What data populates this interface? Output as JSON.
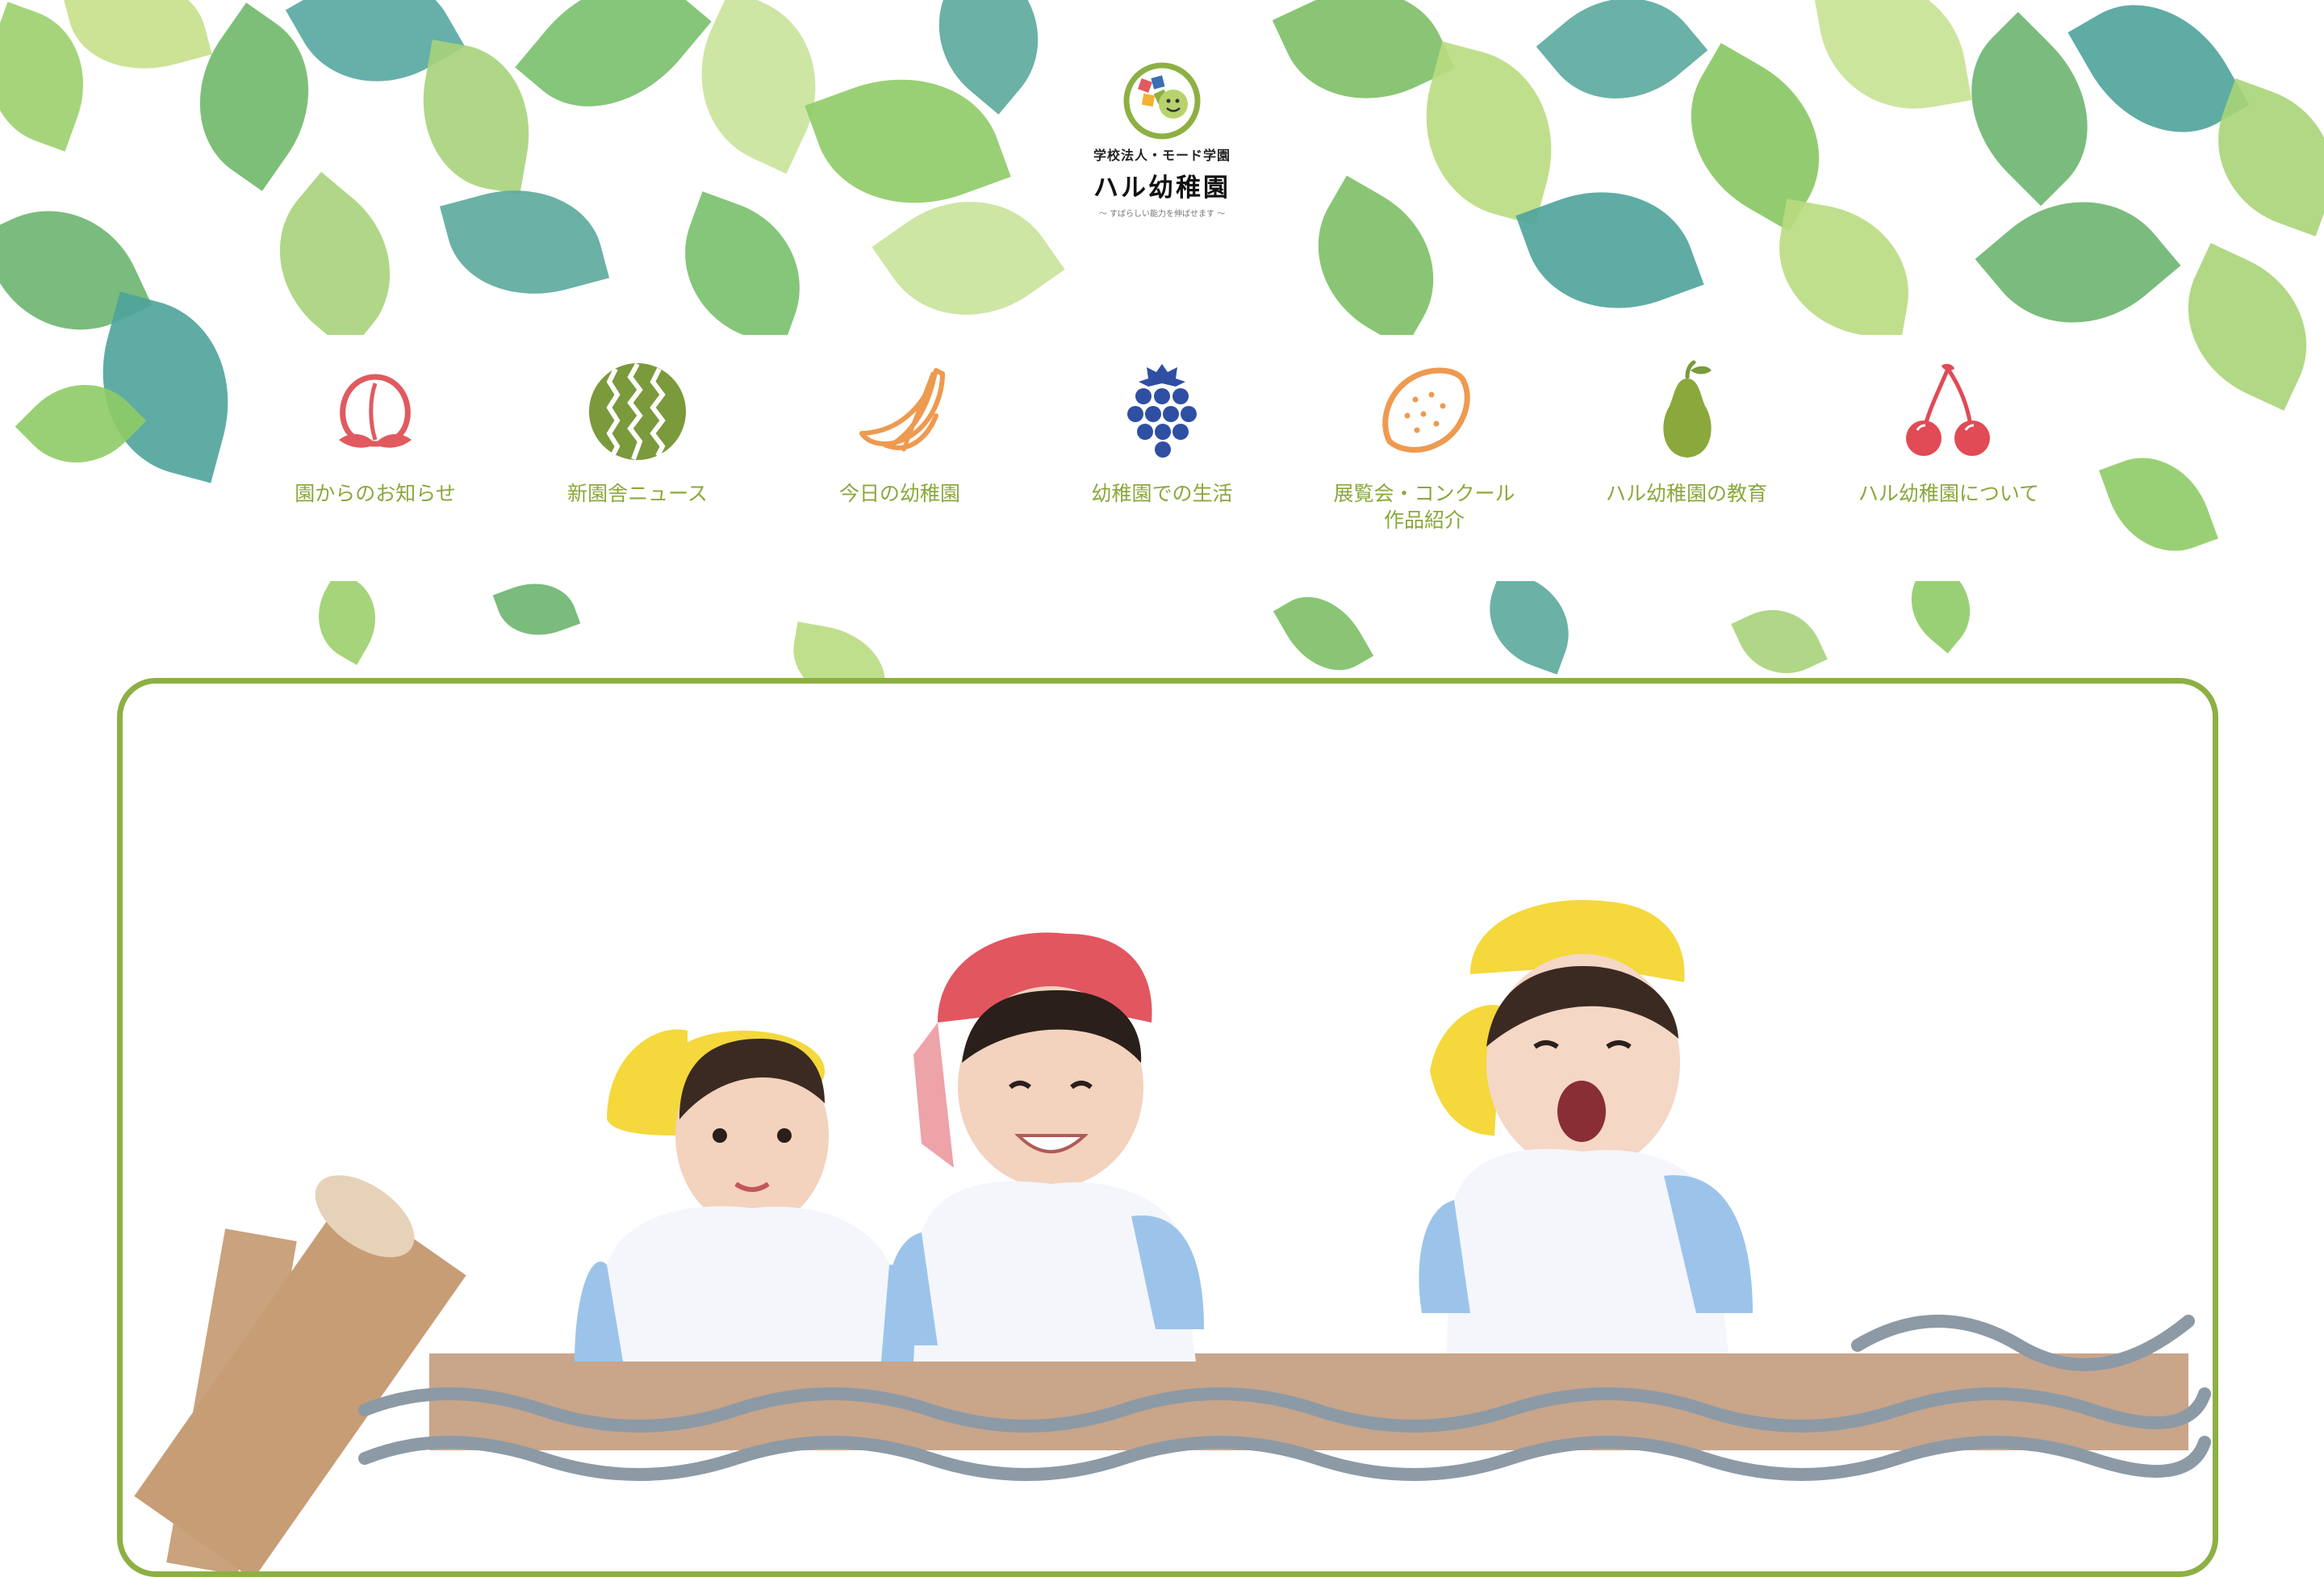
{
  "logo": {
    "org": "学校法人・モード学園",
    "name": "ハル幼稚園",
    "tagline": "～ すばらしい能力を伸ばせます ～"
  },
  "nav": [
    {
      "label": "園からのお知らせ",
      "icon": "peach-icon",
      "color": "#e05a5f"
    },
    {
      "label": "新園舎ニュース",
      "icon": "watermelon-icon",
      "color": "#7a9a3c"
    },
    {
      "label": "今日の幼稚園",
      "icon": "banana-icon",
      "color": "#ee9a4f"
    },
    {
      "label": "幼稚園での生活",
      "icon": "grapes-icon",
      "color": "#2f4fa3"
    },
    {
      "label": "展覧会・コンクール\n作品紹介",
      "icon": "lemon-icon",
      "color": "#ee9a4f"
    },
    {
      "label": "ハル幼稚園の教育",
      "icon": "pear-icon",
      "color": "#8aa83c"
    },
    {
      "label": "ハル幼稚園について",
      "icon": "cherry-icon",
      "color": "#e04b55"
    }
  ],
  "colors": {
    "accent": "#8db043",
    "nav_text": "#8aa83c"
  },
  "hero": {
    "image": "children-playground-photo"
  }
}
